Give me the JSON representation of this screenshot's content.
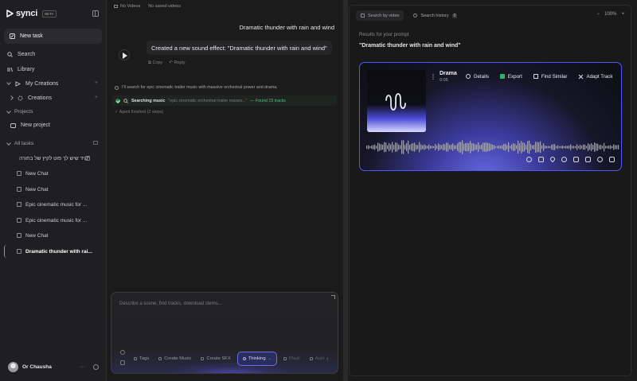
{
  "sidebar": {
    "logo_text": "synci",
    "beta_label": "BETA",
    "new_task_label": "New task",
    "nav": [
      {
        "label": "Search",
        "icon": "search-icon"
      },
      {
        "label": "Library",
        "icon": "library-icon"
      }
    ],
    "my_creations_label": "My Creations",
    "creations_label": "Creations",
    "projects_label": "Projects",
    "new_project_label": "New project",
    "all_tasks_label": "All tasks",
    "tasks": [
      {
        "label": "תגיד שיש לך פוט לקיץ של בחורה"
      },
      {
        "label": "New Chat"
      },
      {
        "label": "New Chat"
      },
      {
        "label": "Epic cinematic music for ..."
      },
      {
        "label": "Epic cinematic music for ..."
      },
      {
        "label": "New Chat"
      },
      {
        "label": "Dramatic thunder with rai..."
      }
    ],
    "user_name": "Or Chausha",
    "user_menu": "···"
  },
  "chat": {
    "top_videos": "No Videos",
    "top_saved": "No saved videos",
    "user_message": "Dramatic thunder with rain and wind",
    "bot_message": "Created a new sound effect: \"Dramatic thunder with rain and wind\"",
    "copy_label": "Copy",
    "reply_label": "Reply",
    "agent_note": "I'll search for epic cinematic trailer music with massive orchestral power and drama.",
    "search_label": "Searching music",
    "search_query": "\"epic cinematic orchestral trailer massiv...\"",
    "search_found": "— Found 15 tracks",
    "agent_done": "Agent finished (2 steps)",
    "composer_placeholder": "Describe a scene, find tracks, download stems...",
    "chips": [
      {
        "label": "Tags",
        "state": "normal"
      },
      {
        "label": "Create Music",
        "state": "normal"
      },
      {
        "label": "Create SFX",
        "state": "normal"
      },
      {
        "label": "Thinking",
        "state": "active"
      },
      {
        "label": "Playli",
        "state": "dim"
      },
      {
        "label": "Auto",
        "state": "dim"
      }
    ],
    "send_icon": "↑",
    "accent": "#6c6cf0"
  },
  "results": {
    "tab_search_video": "Search by video",
    "tab_history": "Search history",
    "history_count": "0",
    "zoom_minus": "−",
    "zoom_level": "100%",
    "zoom_plus": "+",
    "results_for_label": "Results for your prompt",
    "prompt_title": "\"Dramatic thunder with rain and wind\"",
    "track": {
      "title": "Drama",
      "time": "0:05",
      "actions": [
        {
          "label": "Details",
          "icon": "info-icon"
        },
        {
          "label": "Export",
          "icon": "export-icon"
        },
        {
          "label": "Find Similar",
          "icon": "find-similar-icon"
        },
        {
          "label": "Adapt Track",
          "icon": "adapt-track-icon"
        }
      ]
    },
    "card_border": "#4f58ff"
  }
}
